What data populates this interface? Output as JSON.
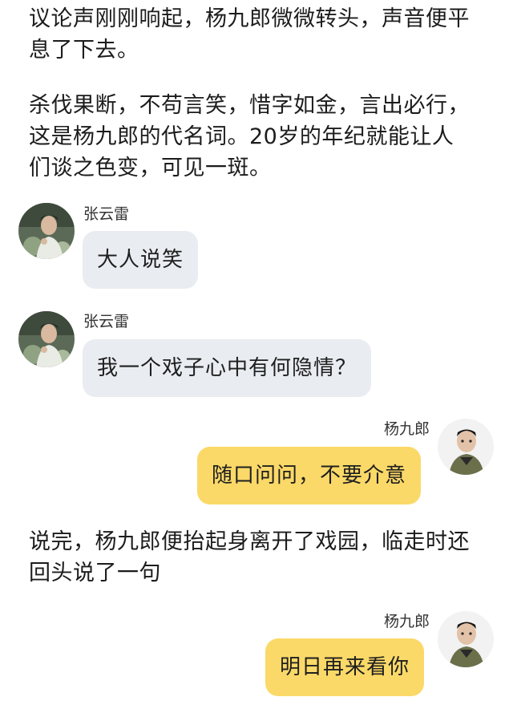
{
  "narration": {
    "p1_line1": "议论声刚刚响起，杨九郎微微转头，声音便平",
    "p1_line2": "息了下去。",
    "p2_line1": "杀伐果断，不苟言笑，惜字如金，言出必行，",
    "p2_line2": "这是杨九郎的代名词。20岁的年纪就能让人",
    "p2_line3": "们谈之色变，可见一斑。",
    "p3_line1": "说完，杨九郎便抬起身离开了戏园，临走时还",
    "p3_line2": "回头说了一句"
  },
  "messages": [
    {
      "sender": "张云雷",
      "text": "大人说笑",
      "side": "left",
      "avatar_icon": "zhang-yunlei-avatar-icon"
    },
    {
      "sender": "张云雷",
      "text": "我一个戏子心中有何隐情？",
      "side": "left",
      "avatar_icon": "zhang-yunlei-avatar-icon"
    },
    {
      "sender": "杨九郎",
      "text": "随口问问，不要介意",
      "side": "right",
      "avatar_icon": "yang-jiulang-avatar-icon"
    },
    {
      "sender": "杨九郎",
      "text": "明日再来看你",
      "side": "right",
      "avatar_icon": "yang-jiulang-avatar-icon"
    }
  ],
  "colors": {
    "left_bubble": "#e9ecf1",
    "right_bubble": "#fbd968",
    "text": "#1c1c1c"
  }
}
